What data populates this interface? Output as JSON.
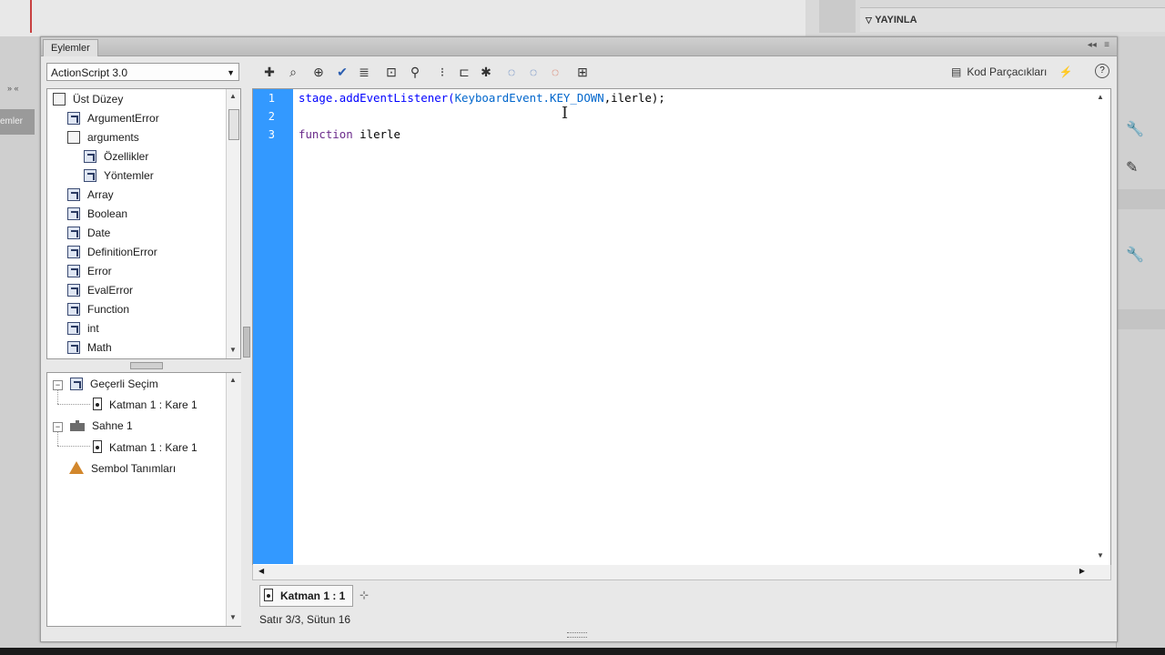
{
  "panel": {
    "title": "Eylemler",
    "language": "ActionScript 3.0"
  },
  "toolbox": {
    "items": [
      {
        "label": "Üst Düzey",
        "icon": "book-icon",
        "indent": 0
      },
      {
        "label": "ArgumentError",
        "icon": "class-icon",
        "indent": 1
      },
      {
        "label": "arguments",
        "icon": "book-icon",
        "indent": 1
      },
      {
        "label": "Özellikler",
        "icon": "class-icon",
        "indent": 2
      },
      {
        "label": "Yöntemler",
        "icon": "class-icon",
        "indent": 2
      },
      {
        "label": "Array",
        "icon": "class-icon",
        "indent": 1
      },
      {
        "label": "Boolean",
        "icon": "class-icon",
        "indent": 1
      },
      {
        "label": "Date",
        "icon": "class-icon",
        "indent": 1
      },
      {
        "label": "DefinitionError",
        "icon": "class-icon",
        "indent": 1
      },
      {
        "label": "Error",
        "icon": "class-icon",
        "indent": 1
      },
      {
        "label": "EvalError",
        "icon": "class-icon",
        "indent": 1
      },
      {
        "label": "Function",
        "icon": "class-icon",
        "indent": 1
      },
      {
        "label": "int",
        "icon": "class-icon",
        "indent": 1
      },
      {
        "label": "Math",
        "icon": "class-icon",
        "indent": 1
      }
    ]
  },
  "tree": {
    "current_selection": "Geçerli Seçim",
    "current_frame": "Katman 1 : Kare 1",
    "scene": "Sahne 1",
    "scene_frame": "Katman 1 : Kare 1",
    "symbols": "Sembol Tanımları"
  },
  "toolbar": {
    "snippets_label": "Kod Parçacıkları",
    "help_label": "?"
  },
  "editor": {
    "lines": [
      {
        "number": "1",
        "parts": {
          "a": "stage.addEventListener(",
          "b": "KeyboardEvent.KEY_DOWN",
          "c": ",ilerle);"
        }
      },
      {
        "number": "2"
      },
      {
        "number": "3",
        "parts": {
          "kw": "function",
          "rest": " ilerle"
        }
      }
    ]
  },
  "script_tab": "Katman 1 : 1",
  "status": "Satır 3/3, Sütun 16",
  "right_panel": {
    "publish_label": "YAYINLA",
    "left_tab_label": "emler"
  },
  "colors": {
    "gutter": "#3399ff",
    "code_method": "#0000ff",
    "keyword": "#6a2a8a"
  }
}
